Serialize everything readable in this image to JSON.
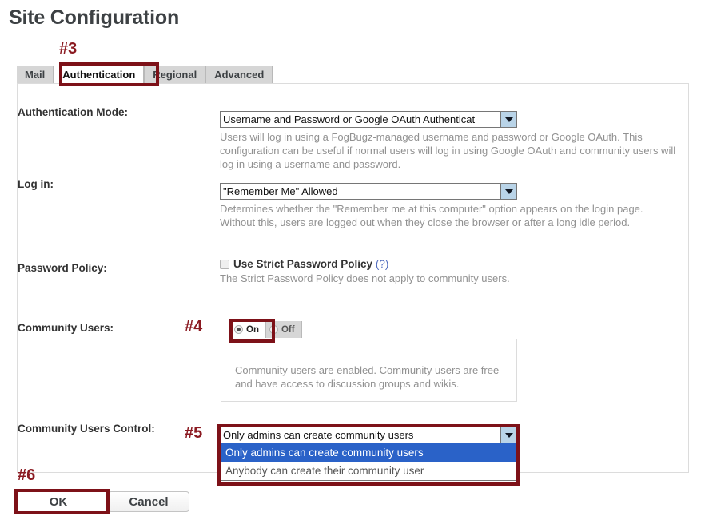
{
  "page": {
    "title": "Site Configuration"
  },
  "tabs": [
    {
      "label": "Mail",
      "selected": false
    },
    {
      "label": "Authentication",
      "selected": true
    },
    {
      "label": "Regional",
      "selected": false
    },
    {
      "label": "Advanced",
      "selected": false
    }
  ],
  "form": {
    "auth_mode": {
      "label": "Authentication Mode:",
      "value": "Username and Password or Google OAuth Authenticat",
      "help": "Users will log in using a FogBugz-managed username and password or Google OAuth. This configuration can be useful if normal users will log in using Google OAuth and community users will log in using a username and password."
    },
    "login": {
      "label": "Log in:",
      "value": "\"Remember Me\" Allowed",
      "help": "Determines whether the \"Remember me at this computer\" option appears on the login page. Without this, users are logged out when they close the browser or after a long idle period."
    },
    "password_policy": {
      "label": "Password Policy:",
      "checkbox_label": "Use Strict Password Policy",
      "help_link": "(?)",
      "checked": false,
      "help": "The Strict Password Policy does not apply to community users."
    },
    "community_users": {
      "label": "Community Users:",
      "on_label": "On",
      "off_label": "Off",
      "selected": "On",
      "info": "Community users are enabled. Community users are free and have access to discussion groups and wikis."
    },
    "community_users_control": {
      "label": "Community Users Control:",
      "value": "Only admins can create community users",
      "options": [
        {
          "label": "Only admins can create community users",
          "highlighted": true
        },
        {
          "label": "Anybody can create their community user",
          "highlighted": false
        }
      ]
    }
  },
  "buttons": {
    "ok": "OK",
    "cancel": "Cancel"
  },
  "annotations": {
    "step3": "#3",
    "step4": "#4",
    "step5": "#5",
    "step6": "#6",
    "color": "#7d1118"
  }
}
